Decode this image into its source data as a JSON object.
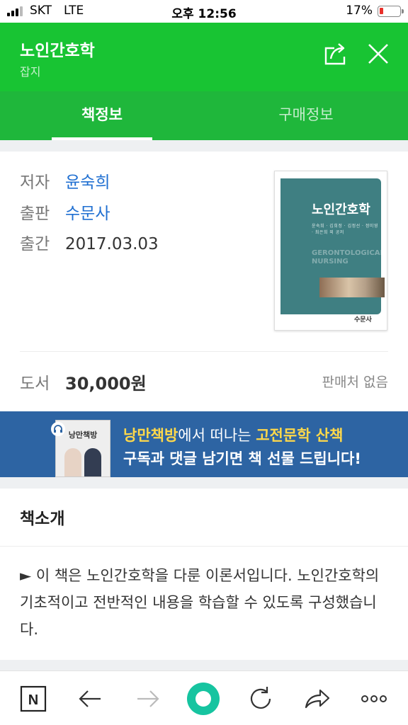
{
  "status_bar": {
    "carrier": "SKT",
    "network": "LTE",
    "time": "오후 12:56",
    "battery_percent": "17%",
    "battery_level": 0.17
  },
  "header": {
    "title": "노인간호학",
    "subtitle": "잡지",
    "share_icon": "share-icon",
    "close_icon": "close-icon"
  },
  "tabs": [
    {
      "label": "책정보",
      "active": true
    },
    {
      "label": "구매정보",
      "active": false
    }
  ],
  "book": {
    "author_label": "저자",
    "author": "윤숙희",
    "publisher_label": "출판",
    "publisher": "수문사",
    "date_label": "출간",
    "date": "2017.03.03",
    "cover": {
      "title": "노인간호학",
      "english_title_1": "GERONTOLOGICAL",
      "english_title_2": "NURSING",
      "authors": "윤숙희 · 김희정 · 김정선 · 정미영 · 최은희 외 공저",
      "publisher": "수문사"
    }
  },
  "price": {
    "label": "도서",
    "value": "30,000원",
    "seller_status": "판매처 없음"
  },
  "banner": {
    "image_title": "낭만책방",
    "line1_highlight": "낭만책방",
    "line1_middle": "에서 떠나는 ",
    "line1_highlight2": "고전문학 산책",
    "line2": "구독과 댓글 남기면 책 선물 드립니다!",
    "accent_color": "#ffd84a"
  },
  "intro": {
    "heading": "책소개",
    "text": "► 이 책은 노인간호학을 다룬 이론서입니다. 노인간호학의 기초적이고 전반적인 내용을 학습할 수 있도록 구성했습니다."
  },
  "toolbar": {
    "items": [
      "naver-home-icon",
      "back-arrow-icon",
      "forward-arrow-icon",
      "green-dot-icon",
      "refresh-icon",
      "share-arrow-icon",
      "more-icon"
    ]
  },
  "colors": {
    "brand_green": "#18c433",
    "tab_green": "#1fb73b",
    "link_blue": "#1f6fd1",
    "banner_blue": "#2d64a3"
  }
}
